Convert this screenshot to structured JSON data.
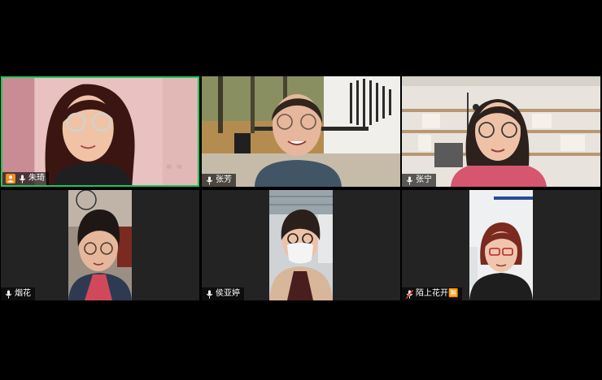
{
  "participants": [
    {
      "name": "朱琦",
      "host": true,
      "active": true,
      "muted": false
    },
    {
      "name": "张芳",
      "host": false,
      "active": false,
      "muted": false
    },
    {
      "name": "张宁",
      "host": false,
      "active": false,
      "muted": false
    },
    {
      "name": "烟花",
      "host": false,
      "active": false,
      "muted": false
    },
    {
      "name": "侯亚婷",
      "host": false,
      "active": false,
      "muted": false
    },
    {
      "name": "陌上花开🈚",
      "host": false,
      "active": false,
      "muted": true
    }
  ],
  "colors": {
    "active_border": "#21c45d",
    "host_badge": "#f28c1b",
    "muted_mic": "#e0403a"
  }
}
